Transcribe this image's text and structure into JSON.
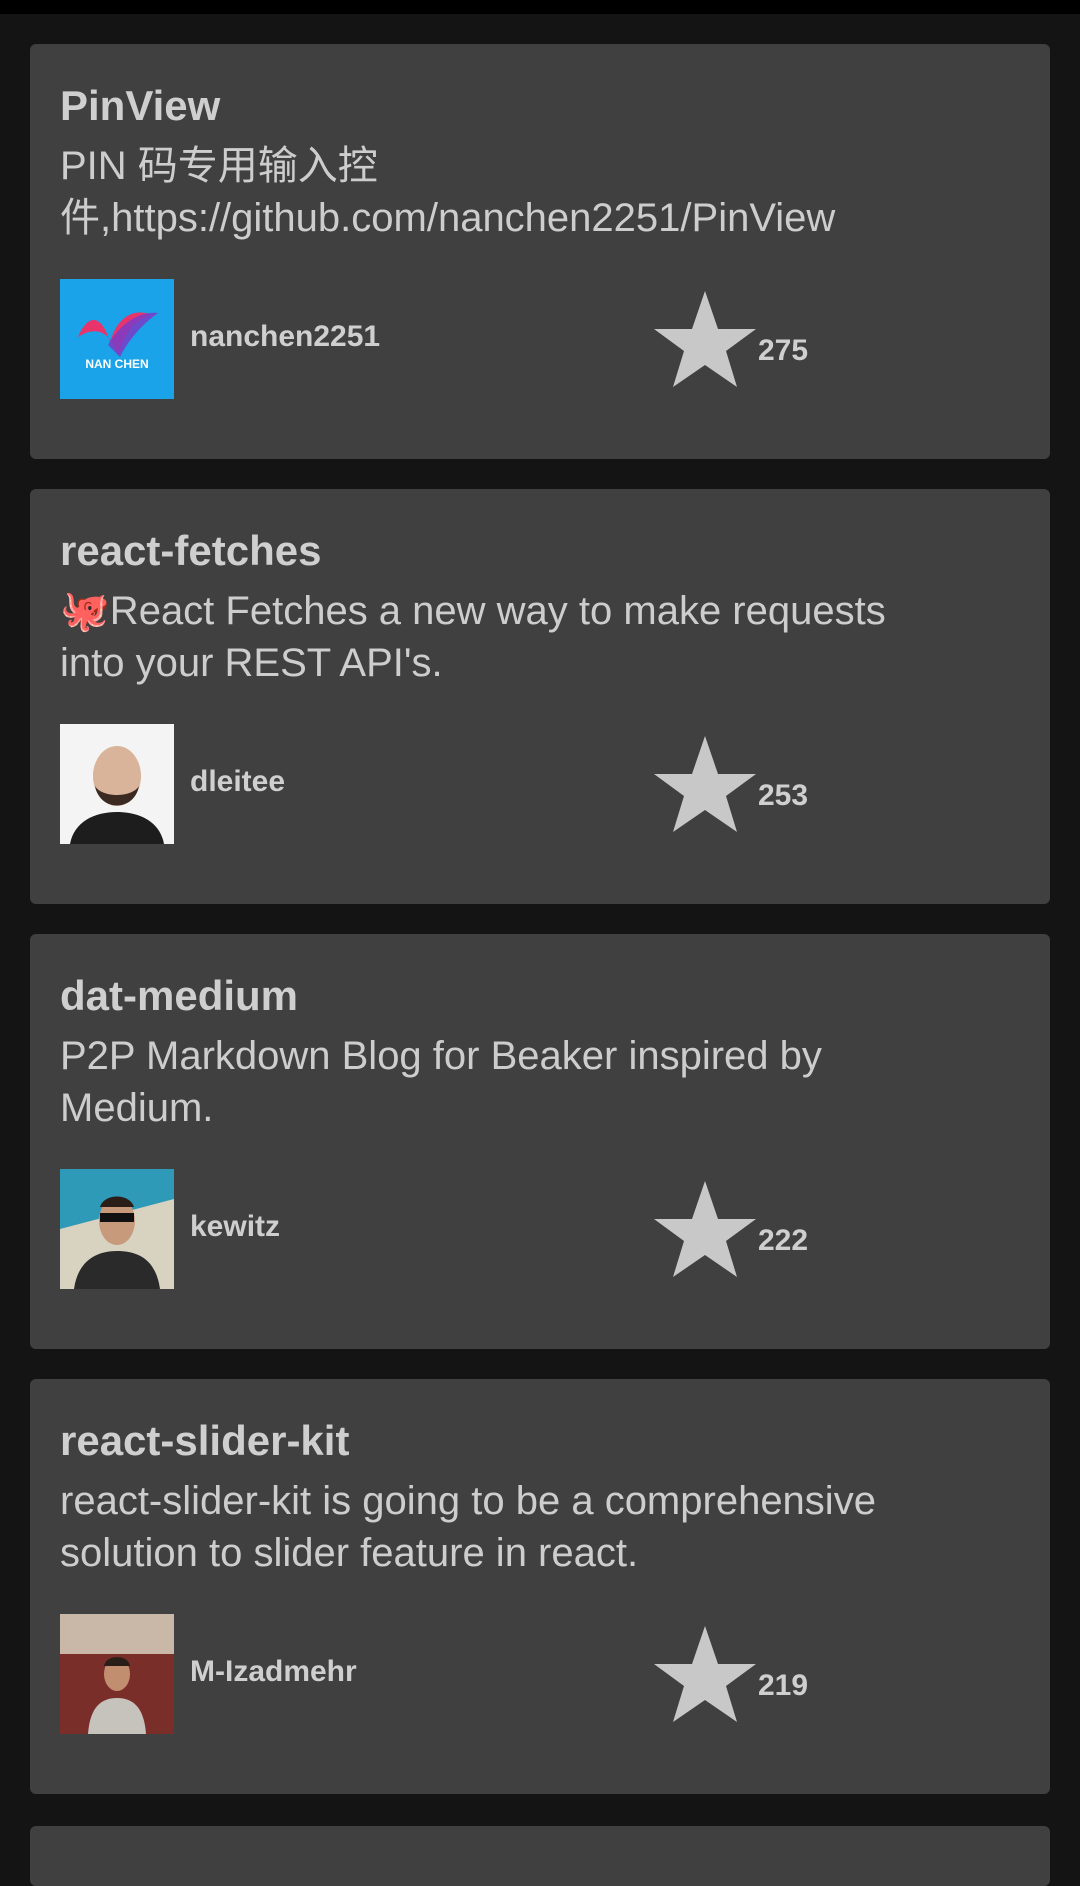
{
  "repos": [
    {
      "name": "PinView",
      "description": "PIN 码专用输入控件,https://github.com/nanchen2251/PinView",
      "owner": "nanchen2251",
      "stars": "275",
      "avatar_logo_text": "NAN CHEN",
      "avatar_bg": "#1aa3e8"
    },
    {
      "name": "react-fetches",
      "description": "🐙React Fetches a new way to make requests into your REST API's.",
      "owner": "dleitee",
      "stars": "253",
      "avatar_bg": "#f4f4f4"
    },
    {
      "name": "dat-medium",
      "description": "P2P Markdown Blog for Beaker inspired by Medium.",
      "owner": "kewitz",
      "stars": "222",
      "avatar_bg": "#2f9ab8"
    },
    {
      "name": "react-slider-kit",
      "description": "react-slider-kit is going to be a comprehensive solution to slider feature in react.",
      "owner": "M-Izadmehr",
      "stars": "219",
      "avatar_bg": "#8a3b35"
    }
  ],
  "colors": {
    "background": "#141414",
    "card": "#404040",
    "text": "#cfcfcf",
    "star": "#c8c8c8"
  }
}
